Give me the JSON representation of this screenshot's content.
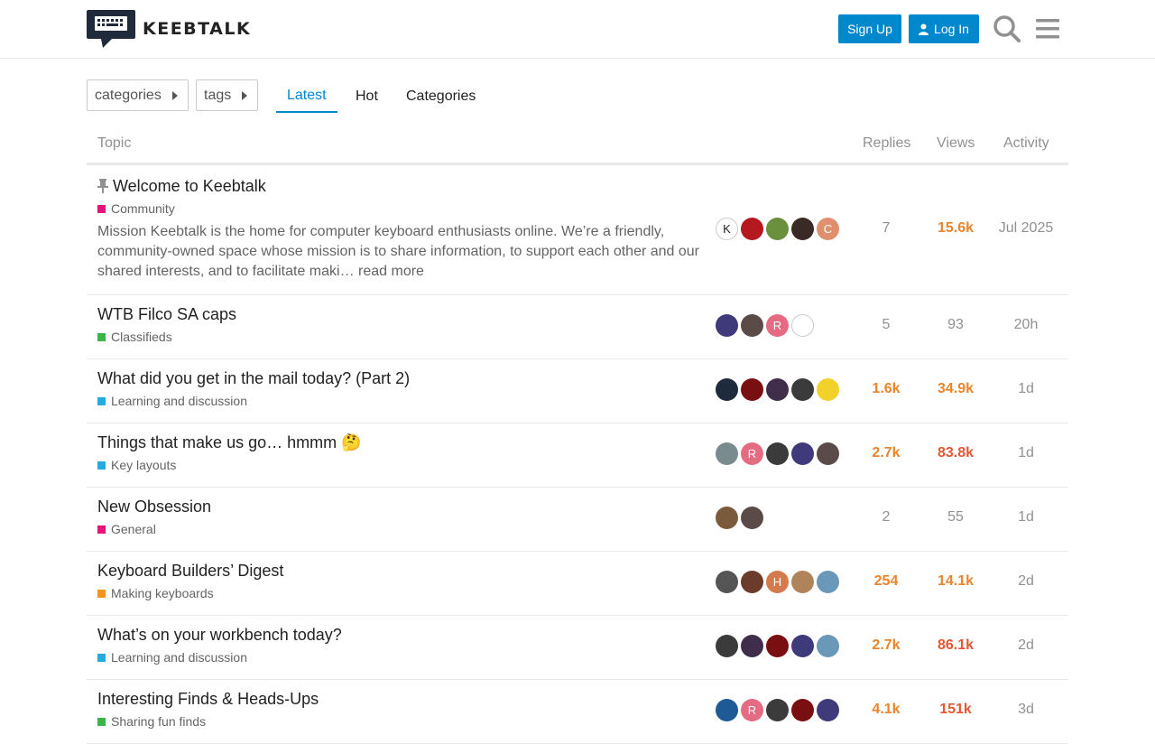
{
  "header": {
    "site_name": "KEEBTALK",
    "signup_label": "Sign Up",
    "login_label": "Log In"
  },
  "nav": {
    "categories_dropdown": "categories",
    "tags_dropdown": "tags",
    "tabs": [
      {
        "label": "Latest",
        "active": true
      },
      {
        "label": "Hot",
        "active": false
      },
      {
        "label": "Categories",
        "active": false
      }
    ]
  },
  "table": {
    "columns": {
      "topic": "Topic",
      "replies": "Replies",
      "views": "Views",
      "activity": "Activity"
    },
    "rows": [
      {
        "title": "Welcome to Keebtalk",
        "pinned": true,
        "category": "Community",
        "category_color": "#e2157a",
        "excerpt": "Mission Keebtalk is the home for computer keyboard enthusiasts online. We’re a friendly, community-owned space whose mission is to share information, to support each other and our shared interests, and to facilitate maki… ",
        "read_more": "read more",
        "replies": "7",
        "views": "15.6k",
        "activity": "Jul 2025",
        "avatars": [
          {
            "letter": "K",
            "bg": "#fff"
          },
          {
            "letter": "",
            "bg": "#b3191e"
          },
          {
            "letter": "",
            "bg": "#6a8f3d"
          },
          {
            "letter": "",
            "bg": "#3a2a25"
          },
          {
            "letter": "C",
            "bg": "#e08f6e"
          }
        ]
      },
      {
        "title": "WTB Filco SA caps",
        "category": "Classifieds",
        "category_color": "#3ab54a",
        "replies": "5",
        "views": "93",
        "activity": "20h",
        "avatars": [
          {
            "letter": "",
            "bg": "#3f3b7a"
          },
          {
            "letter": "",
            "bg": "#5a4a48"
          },
          {
            "letter": "R",
            "bg": "#e56b82"
          },
          {
            "letter": "",
            "bg": "#fff"
          }
        ]
      },
      {
        "title": "What did you get in the mail today? (Part 2)",
        "category": "Learning and discussion",
        "category_color": "#25aae2",
        "replies": "1.6k",
        "views": "34.9k",
        "activity": "1d",
        "avatars": [
          {
            "letter": "",
            "bg": "#1e2b3d"
          },
          {
            "letter": "",
            "bg": "#7a0f12"
          },
          {
            "letter": "",
            "bg": "#402d4b"
          },
          {
            "letter": "",
            "bg": "#3b3b3b"
          },
          {
            "letter": "",
            "bg": "#f2d22a"
          }
        ]
      },
      {
        "title": "Things that make us go… hmmm",
        "emoji": "🤔",
        "category": "Key layouts",
        "category_color": "#25aae2",
        "replies": "2.7k",
        "views": "83.8k",
        "activity": "1d",
        "avatars": [
          {
            "letter": "",
            "bg": "#7a8b90"
          },
          {
            "letter": "R",
            "bg": "#e56b82"
          },
          {
            "letter": "",
            "bg": "#3b3b3b"
          },
          {
            "letter": "",
            "bg": "#3f3b7a"
          },
          {
            "letter": "",
            "bg": "#5a4a48"
          }
        ]
      },
      {
        "title": "New Obsession",
        "category": "General",
        "category_color": "#e2157a",
        "replies": "2",
        "views": "55",
        "activity": "1d",
        "avatars": [
          {
            "letter": "",
            "bg": "#7a5c3d"
          },
          {
            "letter": "",
            "bg": "#5a4a48"
          }
        ]
      },
      {
        "title": "Keyboard Builders’ Digest",
        "category": "Making keyboards",
        "category_color": "#f7941d",
        "replies": "254",
        "views": "14.1k",
        "activity": "2d",
        "avatars": [
          {
            "letter": "",
            "bg": "#555"
          },
          {
            "letter": "",
            "bg": "#6b3b2b"
          },
          {
            "letter": "H",
            "bg": "#d47a4c"
          },
          {
            "letter": "",
            "bg": "#b0845a"
          },
          {
            "letter": "",
            "bg": "#6a98b8"
          }
        ]
      },
      {
        "title": "What’s on your workbench today?",
        "category": "Learning and discussion",
        "category_color": "#25aae2",
        "replies": "2.7k",
        "views": "86.1k",
        "activity": "2d",
        "avatars": [
          {
            "letter": "",
            "bg": "#3b3b3b"
          },
          {
            "letter": "",
            "bg": "#402d4b"
          },
          {
            "letter": "",
            "bg": "#7a0f12"
          },
          {
            "letter": "",
            "bg": "#3f3b7a"
          },
          {
            "letter": "",
            "bg": "#6a98b8"
          }
        ]
      },
      {
        "title": "Interesting Finds & Heads-Ups",
        "category": "Sharing fun finds",
        "category_color": "#3ab54a",
        "replies": "4.1k",
        "views": "151k",
        "activity": "3d",
        "avatars": [
          {
            "letter": "",
            "bg": "#1e5a96"
          },
          {
            "letter": "R",
            "bg": "#e56b82"
          },
          {
            "letter": "",
            "bg": "#3b3b3b"
          },
          {
            "letter": "",
            "bg": "#7a0f12"
          },
          {
            "letter": "",
            "bg": "#3f3b7a"
          }
        ]
      }
    ]
  }
}
